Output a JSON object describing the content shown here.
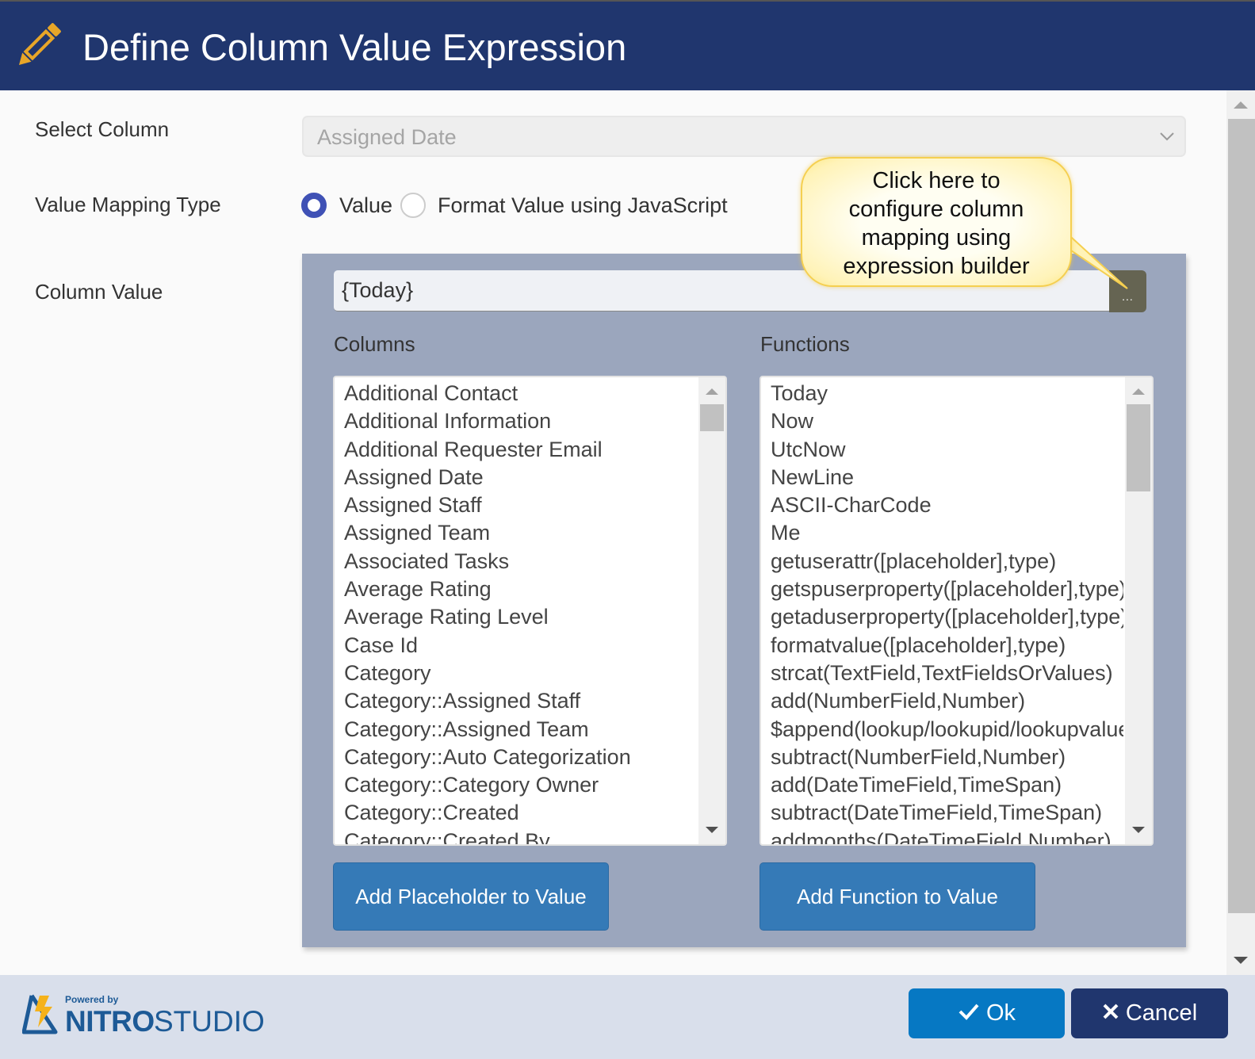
{
  "header": {
    "title": "Define Column Value Expression",
    "icon": "pencil-icon"
  },
  "form": {
    "select_column": {
      "label": "Select Column",
      "value": "Assigned Date"
    },
    "value_mapping_type": {
      "label": "Value Mapping Type",
      "options": [
        {
          "label": "Value",
          "selected": true
        },
        {
          "label": "Format Value using JavaScript",
          "selected": false
        }
      ]
    },
    "column_value": {
      "label": "Column Value",
      "value": "{Today}",
      "builder_button_label": "..."
    }
  },
  "callout": {
    "lines": [
      "Click here to",
      "configure column",
      "mapping using",
      "expression builder"
    ]
  },
  "columns": {
    "label": "Columns",
    "items": [
      "Additional Contact",
      "Additional Information",
      "Additional Requester Email",
      "Assigned Date",
      "Assigned Staff",
      "Assigned Team",
      "Associated Tasks",
      "Average Rating",
      "Average Rating Level",
      "Case Id",
      "Category",
      "Category::Assigned Staff",
      "Category::Assigned Team",
      "Category::Auto Categorization",
      "Category::Category Owner",
      "Category::Created",
      "Category::Created By"
    ],
    "add_button": "Add Placeholder to Value"
  },
  "functions": {
    "label": "Functions",
    "items": [
      "Today",
      "Now",
      "UtcNow",
      "NewLine",
      "ASCII-CharCode",
      "Me",
      "getuserattr([placeholder],type)",
      "getspuserproperty([placeholder],type)",
      "getaduserproperty([placeholder],type)",
      "formatvalue([placeholder],type)",
      "strcat(TextField,TextFieldsOrValues)",
      "add(NumberField,Number)",
      "$append(lookup/lookupid/lookupvalue)",
      "subtract(NumberField,Number)",
      "add(DateTimeField,TimeSpan)",
      "subtract(DateTimeField,TimeSpan)",
      "addmonths(DateTimeField,Number)"
    ],
    "add_button": "Add Function to Value"
  },
  "footer": {
    "logo": {
      "powered_by": "Powered by",
      "brand_bold": "NITRO",
      "brand_light": "STUDIO"
    },
    "ok_label": "Ok",
    "cancel_label": "Cancel"
  },
  "colors": {
    "header_bg": "#20366e",
    "panel_bg": "#9ba6bd",
    "primary_button": "#357ab7",
    "ok_button": "#0678c3",
    "cancel_button": "#20366e",
    "radio_accent": "#3f51b5",
    "pencil": "#e8a628"
  }
}
